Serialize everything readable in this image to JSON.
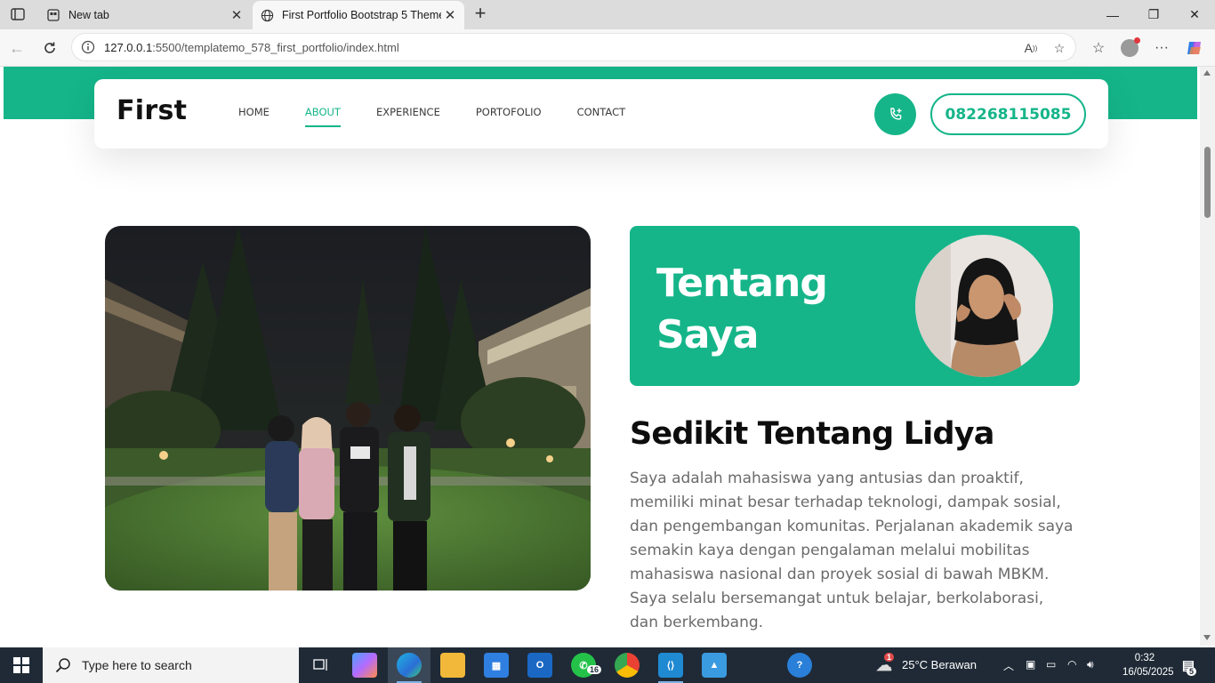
{
  "browser": {
    "tabs": [
      {
        "title": "New tab",
        "active": false
      },
      {
        "title": "First Portfolio Bootstrap 5 Theme",
        "active": true
      }
    ],
    "address": {
      "host": "127.0.0.1",
      "rest": ":5500/templatemo_578_first_portfolio/index.html"
    }
  },
  "page": {
    "brand": "First",
    "menu": [
      {
        "label": "HOME",
        "active": false
      },
      {
        "label": "ABOUT",
        "active": true
      },
      {
        "label": "EXPERIENCE",
        "active": false
      },
      {
        "label": "PORTOFOLIO",
        "active": false
      },
      {
        "label": "CONTACT",
        "active": false
      }
    ],
    "phone": "082268115085",
    "about_title_line1": "Tentang",
    "about_title_line2": "Saya",
    "heading": "Sedikit Tentang Lidya",
    "paragraph": "Saya adalah mahasiswa yang antusias dan proaktif, memiliki minat besar terhadap teknologi, dampak sosial, dan pengembangan komunitas. Perjalanan akademik saya semakin kaya dengan pengalaman melalui mobilitas mahasiswa nasional dan proyek sosial di bawah MBKM. Saya selalu bersemangat untuk belajar, berkolaborasi, dan berkembang.",
    "accent_color": "#15b589"
  },
  "taskbar": {
    "search_placeholder": "Type here to search",
    "weather": "25°C  Berawan",
    "weather_badge": "1",
    "whatsapp_badge": "16",
    "time": "0:32",
    "date": "16/05/2025",
    "notifications": "5"
  }
}
